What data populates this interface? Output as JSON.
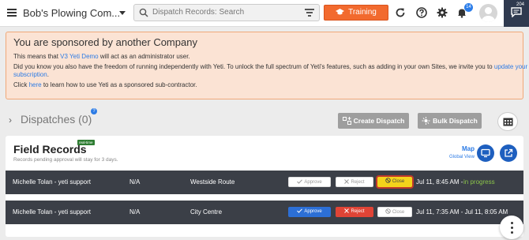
{
  "header": {
    "company": "Bob's Plowing Com...",
    "search_placeholder": "Dispatch Records: Search",
    "training_label": "Training",
    "notification_count": "14",
    "chat_count": "204"
  },
  "sponsor": {
    "title": "You are sponsored by another Company",
    "line1_a": "This means that",
    "line1_link": "V3 Yeti Demo",
    "line1_b": "will act as an administrator user.",
    "line2_a": "Did you know you also have the freedom of running independently with Yeti. To unlock the full spectrum of Yeti's features, such as adding in your own Sites, we invite you to",
    "line2_link": "update your",
    "line3_link": "subscription",
    "line3_b": ".",
    "line4_a": "Click",
    "line4_link": "here",
    "line4_b": "to learn how to use Yeti as a sponsored sub-contractor."
  },
  "dispatches": {
    "title": "Dispatches (0)",
    "help": "?",
    "create_label": "Create Dispatch",
    "bulk_label": "Bulk Dispatch"
  },
  "field_records": {
    "title": "Field Records",
    "realtime_badge": "real-time",
    "subtitle": "Records pending approval will stay for 3 days.",
    "map_label": "Map",
    "map_sub": "Global View",
    "approve_label": "Approve",
    "reject_label": "Reject",
    "close_label": "Close",
    "rows": [
      {
        "name": "Michelle Tolan - yeti support",
        "value": "N/A",
        "site": "Westside Route",
        "time": "Jul 11, 8:45 AM -",
        "status": "in progress"
      },
      {
        "name": "Michelle Tolan - yeti support",
        "value": "N/A",
        "site": "City Centre",
        "time": "Jul 11, 7:35 AM - Jul 11, 8:05 AM",
        "status": ""
      }
    ]
  },
  "icons": {
    "menu": "hamburger-icon",
    "search": "search-icon",
    "filter": "filter-icon",
    "training": "training-icon",
    "refresh": "refresh-icon",
    "help": "help-icon",
    "settings": "gear-icon",
    "notifications": "bell-icon",
    "chat": "chat-icon"
  },
  "colors": {
    "training": "#f26a2e",
    "banner_bg": "#fbe3d4",
    "row_bg": "#3b3f47",
    "approve": "#2c6fd6",
    "reject": "#e04436",
    "close_active": "#f4d31b",
    "status_green": "#8bc34a"
  }
}
